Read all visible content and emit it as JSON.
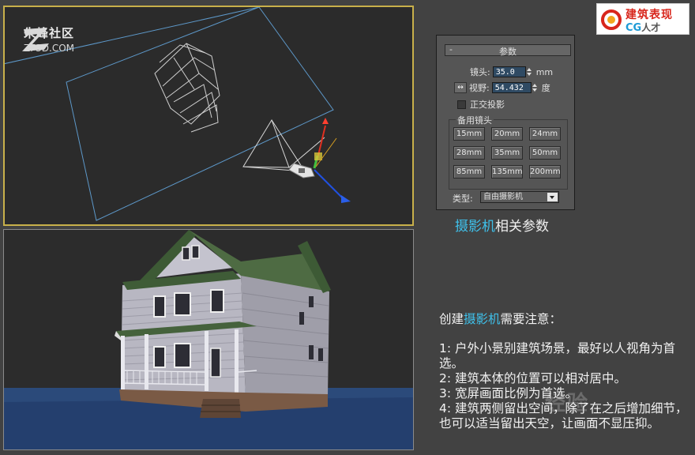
{
  "watermark_left": {
    "title": "朱峰社区",
    "url": "ZF3D.COM"
  },
  "logo": {
    "line1": "建筑表现",
    "line2_a": "CG",
    "line2_b": "人才",
    "colors": {
      "red": "#d8261c",
      "blue": "#1d9ad6"
    }
  },
  "panel": {
    "rollout_toggle": "-",
    "rollout_title": "参数",
    "lens_label": "镜头:",
    "lens_value": "35.0",
    "lens_unit": "mm",
    "fov_label": "视野:",
    "fov_value": "54.432",
    "fov_unit": "度",
    "ortho_label": "正交投影",
    "ortho_checked": false,
    "stock_lenses_label": "备用镜头",
    "stock_lenses": [
      "15mm",
      "20mm",
      "24mm",
      "28mm",
      "35mm",
      "50mm",
      "85mm",
      "135mm",
      "200mm"
    ],
    "type_label": "类型:",
    "type_value": "自由摄影机"
  },
  "caption": {
    "highlight": "摄影机",
    "rest": "相关参数"
  },
  "notes": {
    "heading_prefix": "创建",
    "heading_highlight": "摄影机",
    "heading_suffix": "需要注意：",
    "items": [
      "1: 户外小景别建筑场景，最好以人视角为首选。",
      "2: 建筑本体的位置可以相对居中。",
      "3: 宽屏画面比例为首选。",
      "4: 建筑两侧留出空间，除了在之后增加细节，也可以适当留出天空，让画面不显压抑。"
    ]
  },
  "bottom_watermark": "经验",
  "colors": {
    "accent_cyan": "#3fc0ea",
    "active_viewport_border": "#c8b04a",
    "spinner_bg": "#2f4a63"
  }
}
